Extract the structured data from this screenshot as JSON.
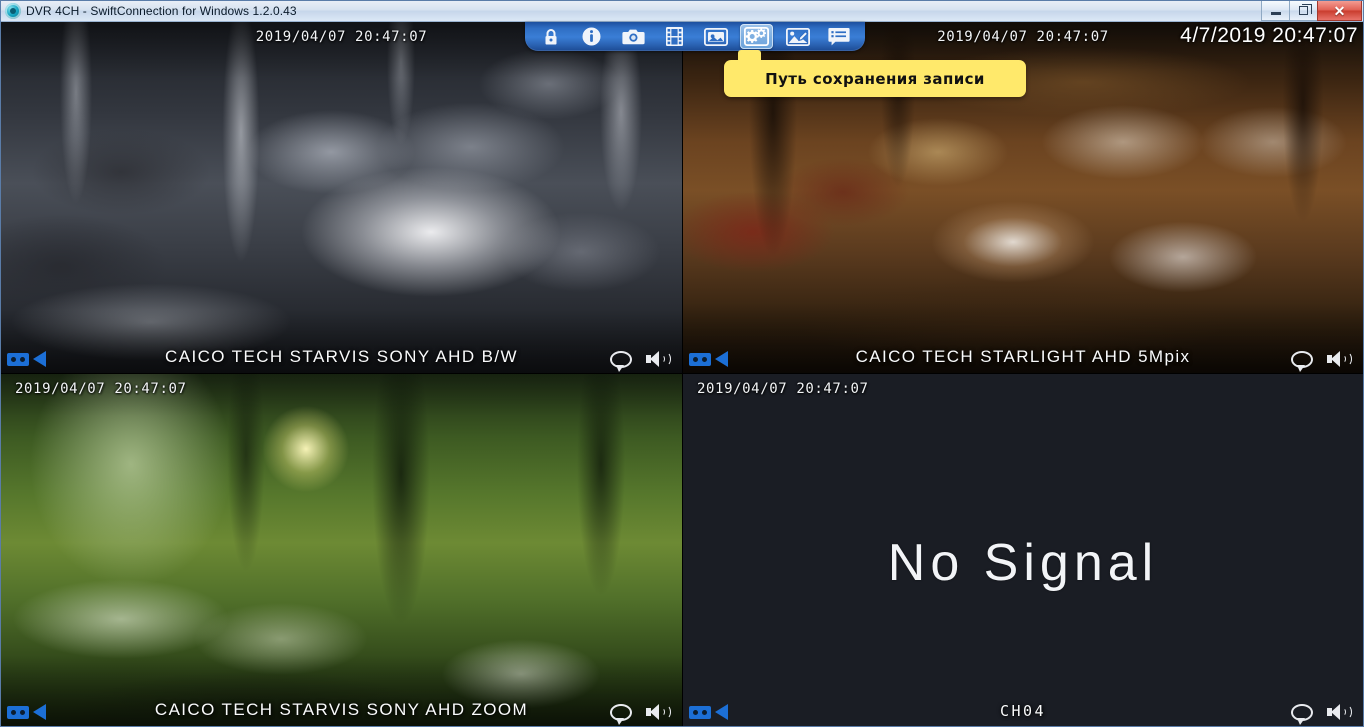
{
  "window": {
    "title": "DVR 4CH - SwiftConnection for Windows 1.2.0.43",
    "app_icon": "app-logo-icon",
    "buttons": {
      "minimize": "minimize-button",
      "restore": "restore-button",
      "close": "✕"
    }
  },
  "toolbar": {
    "items": [
      {
        "name": "lock-icon",
        "label": "Lock",
        "active": false
      },
      {
        "name": "info-icon",
        "label": "Info",
        "active": false
      },
      {
        "name": "camera-icon",
        "label": "Snapshot",
        "active": false
      },
      {
        "name": "film-icon",
        "label": "Record",
        "active": false
      },
      {
        "name": "display-icon",
        "label": "Display",
        "active": false
      },
      {
        "name": "gear-icon",
        "label": "Settings",
        "active": true
      },
      {
        "name": "image-edit-icon",
        "label": "Image",
        "active": false
      },
      {
        "name": "list-icon",
        "label": "List",
        "active": false
      }
    ]
  },
  "tooltip": {
    "text": "Путь сохранения записи",
    "background": "#ffe96b"
  },
  "clock": {
    "datetime": "4/7/2019 20:47:07"
  },
  "panes": [
    {
      "id": "ch01",
      "timestamp": "2019/04/07 20:47:07",
      "label": "CAICO TECH STARVIS SONY AHD B/W",
      "signal": true,
      "icons": {
        "record": "tape-icon",
        "play": "play-left-icon",
        "talk": "speech-bubble-icon",
        "audio": "speaker-icon"
      }
    },
    {
      "id": "ch02",
      "timestamp": "2019/04/07 20:47:07",
      "label": "CAICO TECH STARLIGHT AHD 5Mpix",
      "signal": true,
      "icons": {
        "record": "tape-icon",
        "play": "play-left-icon",
        "talk": "speech-bubble-icon",
        "audio": "speaker-icon"
      }
    },
    {
      "id": "ch03",
      "timestamp": "2019/04/07 20:47:07",
      "label": "CAICO TECH STARVIS SONY AHD ZOOM",
      "signal": true,
      "icons": {
        "record": "tape-icon",
        "play": "play-left-icon",
        "talk": "speech-bubble-icon",
        "audio": "speaker-icon"
      }
    },
    {
      "id": "ch04",
      "timestamp": "2019/04/07 20:47:07",
      "label": "CH04",
      "signal": false,
      "no_signal_text": "No Signal",
      "icons": {
        "record": "tape-icon",
        "play": "play-left-icon",
        "talk": "speech-bubble-icon",
        "audio": "speaker-icon"
      }
    }
  ],
  "colors": {
    "toolbar_blue": "#3a7ed6",
    "tooltip_yellow": "#ffe96b",
    "rec_icon_blue": "#1c6fd6",
    "no_signal_bg": "#1a1d24",
    "titlebar": "#d6e2f0"
  }
}
